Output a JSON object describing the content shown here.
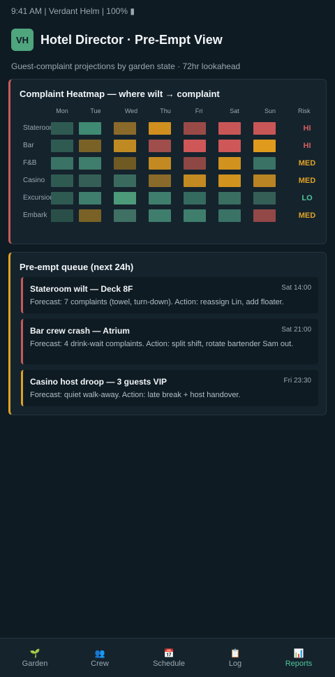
{
  "status_bar": "9:41 AM | Verdant Helm | 100% ▮",
  "header": {
    "avatar": "VH",
    "title": "Hotel Director · Pre-Empt View"
  },
  "subtitle": "Guest-complaint projections by garden state · 72hr lookahead",
  "heatmap": {
    "title": "Complaint Heatmap — where wilt → complaint",
    "days": [
      "Mon",
      "Tue",
      "Wed",
      "Thu",
      "Fri",
      "Sat",
      "Sun"
    ],
    "risk_label": "Risk",
    "rows": [
      {
        "label": "Stateroom",
        "risk": "HI",
        "cells": [
          "#2f5a52",
          "#3f8a72",
          "#8a6a2a",
          "#d08f1f",
          "#9a4a46",
          "#c85656",
          "#c85656"
        ]
      },
      {
        "label": "Bar",
        "risk": "HI",
        "cells": [
          "#2f5a52",
          "#7a6226",
          "#c08a22",
          "#a04e4b",
          "#cf5757",
          "#cf5757",
          "#e09a1c"
        ]
      },
      {
        "label": "F&B",
        "risk": "MED",
        "cells": [
          "#3a7266",
          "#3f7e6c",
          "#6f5a24",
          "#c38a22",
          "#8e4744",
          "#d1921e",
          "#3a7266"
        ]
      },
      {
        "label": "Casino",
        "risk": "MED",
        "cells": [
          "#2f5a52",
          "#355f56",
          "#3a6a5e",
          "#8a6a2a",
          "#c38a22",
          "#d1921e",
          "#b98423"
        ]
      },
      {
        "label": "Excursion",
        "risk": "LO",
        "cells": [
          "#2f5a52",
          "#3f7e6c",
          "#4c9a7a",
          "#3f7e6c",
          "#356a5e",
          "#3a6e60",
          "#355f56"
        ]
      },
      {
        "label": "Embark",
        "risk": "MED",
        "cells": [
          "#2a4f48",
          "#7a6226",
          "#3f7064",
          "#3f7e6c",
          "#3f7e6c",
          "#3a7266",
          "#934848"
        ]
      }
    ],
    "risk_colors": {
      "HI": "#d35f5f",
      "MED": "#e0a226",
      "LO": "#4fc59a"
    }
  },
  "queue": {
    "title": "Pre-empt queue (next 24h)",
    "items": [
      {
        "title": "Stateroom wilt — Deck 8F",
        "time": "Sat 14:00",
        "desc": "Forecast: 7 complaints (towel, turn-down). Action: reassign Lin, add floater."
      },
      {
        "title": "Bar crew crash — Atrium",
        "time": "Sat 21:00",
        "desc": "Forecast: 4 drink-wait complaints. Action: split shift, rotate bartender Sam out."
      },
      {
        "title": "Casino host droop — 3 guests VIP",
        "time": "Fri 23:30",
        "desc": "Forecast: quiet walk-away. Action: late break + host handover."
      }
    ]
  },
  "tabs": [
    {
      "icon": "🌱",
      "label": "Garden"
    },
    {
      "icon": "👥",
      "label": "Crew"
    },
    {
      "icon": "📅",
      "label": "Schedule"
    },
    {
      "icon": "📋",
      "label": "Log"
    },
    {
      "icon": "📊",
      "label": "Reports"
    }
  ]
}
